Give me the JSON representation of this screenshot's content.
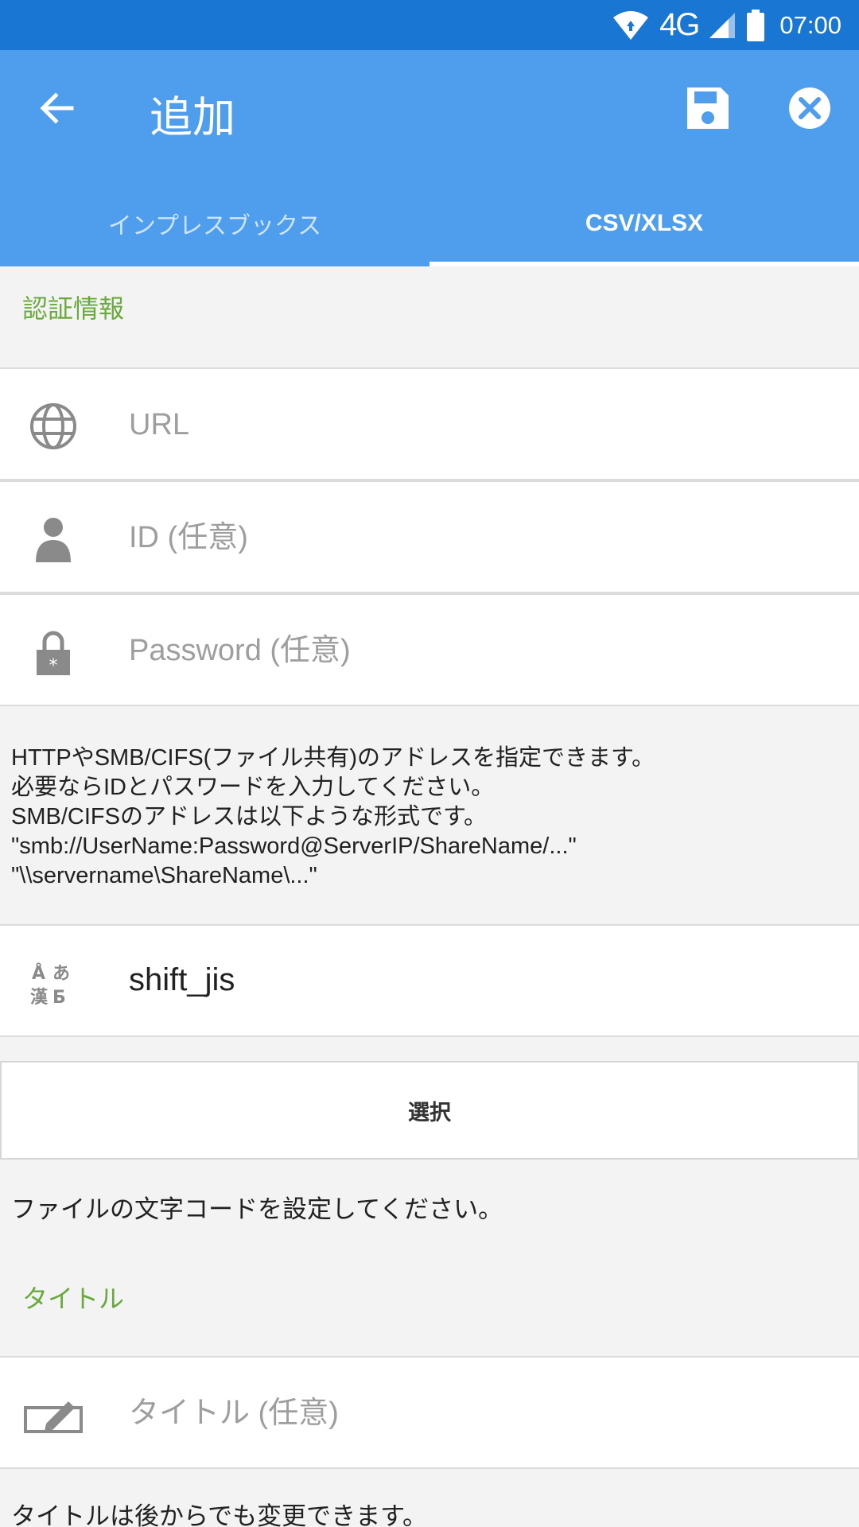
{
  "status_bar": {
    "network": "4G",
    "time": "07:00"
  },
  "app_bar": {
    "title": "追加",
    "icons": [
      "back-arrow-icon",
      "save-icon",
      "close-circle-icon"
    ]
  },
  "tabs": [
    {
      "label": "インプレスブックス",
      "active": false
    },
    {
      "label": "CSV/XLSX",
      "active": true
    }
  ],
  "auth": {
    "section_label": "認証情報",
    "url_placeholder": "URL",
    "id_placeholder": "ID (任意)",
    "password_placeholder": "Password (任意)",
    "hint": "HTTPやSMB/CIFS(ファイル共有)のアドレスを指定できます。\n必要ならIDとパスワードを入力してください。\nSMB/CIFSのアドレスは以下ような形式です。\n\"smb://UserName:Password@ServerIP/ShareName/...\"\n\"\\\\servername\\ShareName\\...\""
  },
  "encoding": {
    "value": "shift_jis",
    "select_label": "選択",
    "hint": "ファイルの文字コードを設定してください。"
  },
  "title_section": {
    "section_label": "タイトル",
    "title_placeholder": "タイトル (任意)",
    "hint": "タイトルは後からでも変更できます。"
  },
  "colors": {
    "status_bar": "#1976d2",
    "app_bar": "#4f9eed",
    "section_label": "#6aaa3c",
    "background": "#f3f3f3"
  }
}
